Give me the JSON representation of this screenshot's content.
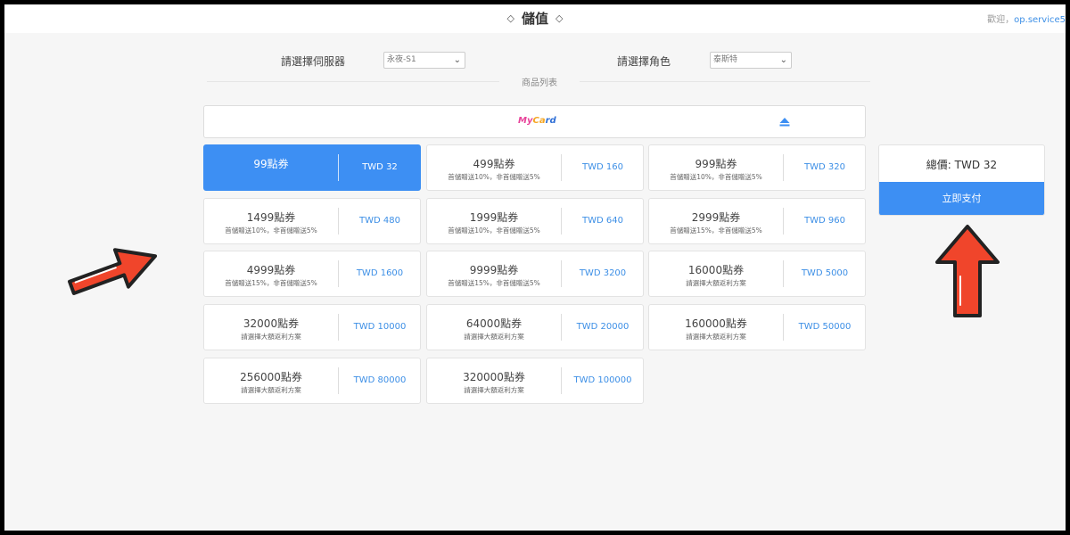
{
  "header": {
    "title": "儲值",
    "welcome_prefix": "歡迎，",
    "user": "op.service5"
  },
  "selectors": {
    "server_label": "請選擇伺服器",
    "server_value": "永夜-S1",
    "role_label": "請選擇角色",
    "role_value": "泰斯特"
  },
  "product_list_label": "商品列表",
  "payment": {
    "logo_text_1": "My",
    "logo_text_2": "Ca",
    "logo_text_3": "rd"
  },
  "products": [
    {
      "name": "99點券",
      "note": "",
      "price": "TWD 32",
      "selected": true
    },
    {
      "name": "499點券",
      "note": "首儲贈送10%，非首儲贈送5%",
      "price": "TWD 160"
    },
    {
      "name": "999點券",
      "note": "首儲贈送10%，非首儲贈送5%",
      "price": "TWD 320"
    },
    {
      "name": "1499點券",
      "note": "首儲贈送10%，非首儲贈送5%",
      "price": "TWD 480"
    },
    {
      "name": "1999點券",
      "note": "首儲贈送10%，非首儲贈送5%",
      "price": "TWD 640"
    },
    {
      "name": "2999點券",
      "note": "首儲贈送15%，非首儲贈送5%",
      "price": "TWD 960"
    },
    {
      "name": "4999點券",
      "note": "首儲贈送15%，非首儲贈送5%",
      "price": "TWD 1600"
    },
    {
      "name": "9999點券",
      "note": "首儲贈送15%，非首儲贈送5%",
      "price": "TWD 3200"
    },
    {
      "name": "16000點券",
      "note": "請選擇大額返利方案",
      "price": "TWD 5000"
    },
    {
      "name": "32000點券",
      "note": "請選擇大額返利方案",
      "price": "TWD 10000"
    },
    {
      "name": "64000點券",
      "note": "請選擇大額返利方案",
      "price": "TWD 20000"
    },
    {
      "name": "160000點券",
      "note": "請選擇大額返利方案",
      "price": "TWD 50000"
    },
    {
      "name": "256000點券",
      "note": "請選擇大額返利方案",
      "price": "TWD 80000"
    },
    {
      "name": "320000點券",
      "note": "請選擇大額返利方案",
      "price": "TWD 100000"
    }
  ],
  "summary": {
    "total": "總價: TWD 32",
    "pay_button": "立即支付"
  },
  "colors": {
    "accent": "#3d8ff3",
    "arrow": "#f0452b"
  }
}
